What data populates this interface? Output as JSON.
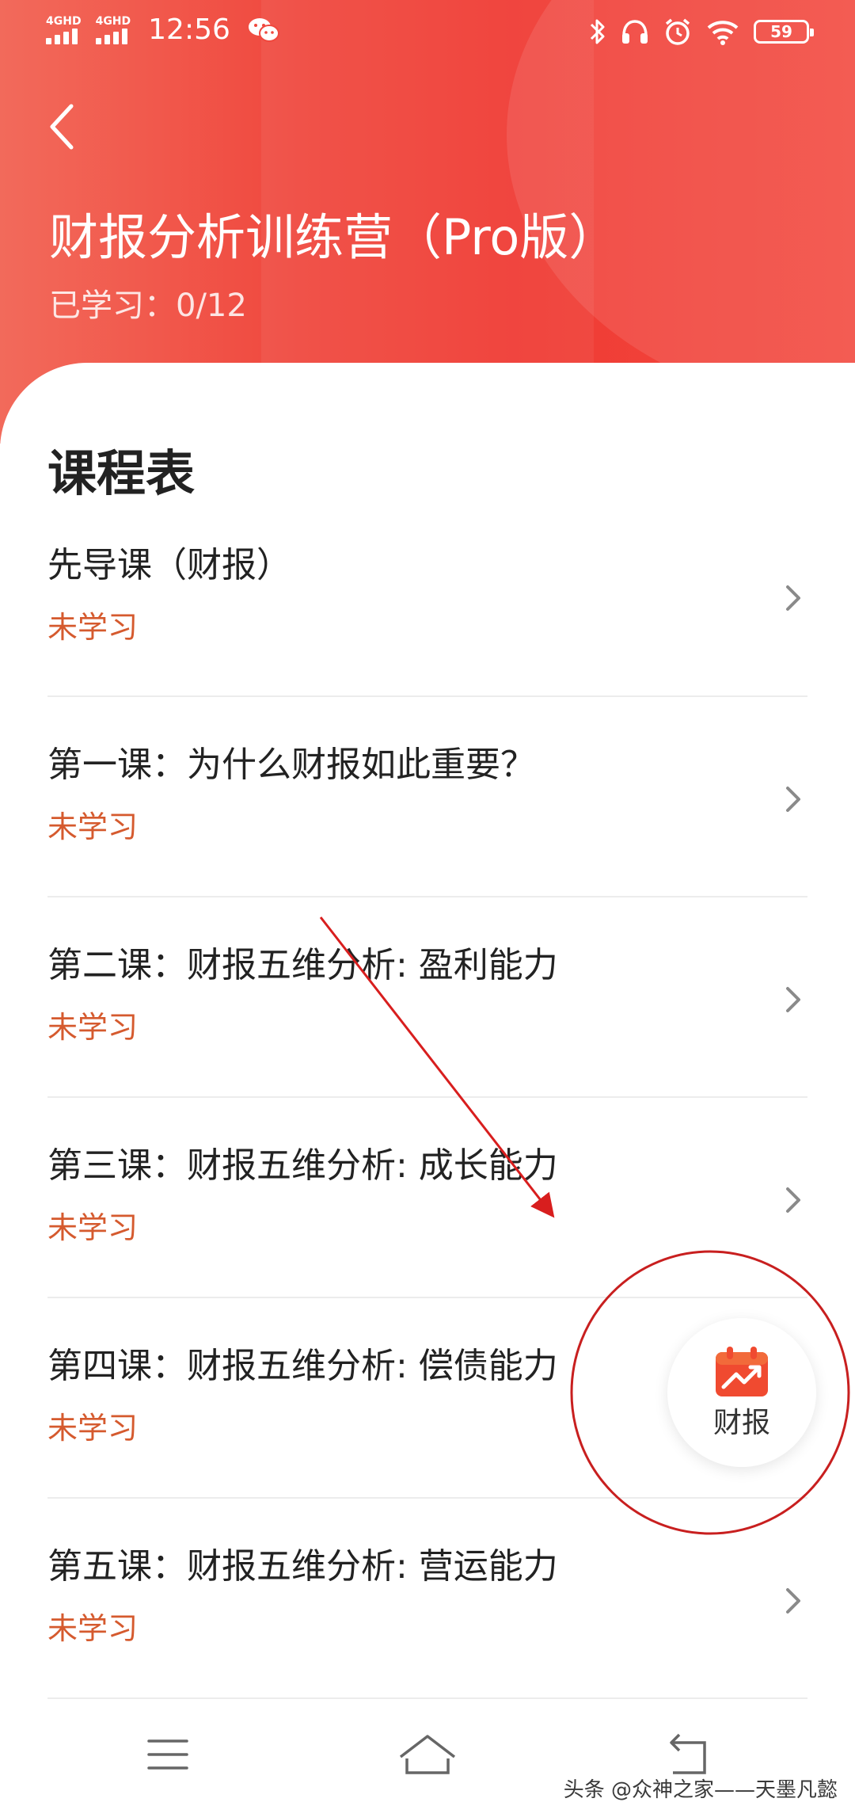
{
  "status_bar": {
    "signal_1": "4GHD",
    "signal_2": "4GHD",
    "time": "12:56",
    "battery": "59",
    "icons": [
      "wechat-icon",
      "bluetooth-icon",
      "headphones-icon",
      "alarm-icon",
      "wifi-icon",
      "battery-icon"
    ]
  },
  "header": {
    "title": "财报分析训练营（Pro版）",
    "progress": "已学习：0/12",
    "back_icon": "back-arrow-icon"
  },
  "schedule": {
    "title": "课程表",
    "lessons": [
      {
        "title": "先导课（财报）",
        "status": "未学习"
      },
      {
        "title": "第一课：为什么财报如此重要？",
        "status": "未学习"
      },
      {
        "title": "第二课：财报五维分析: 盈利能力",
        "status": "未学习"
      },
      {
        "title": "第三课：财报五维分析: 成长能力",
        "status": "未学习"
      },
      {
        "title": "第四课：财报五维分析: 偿债能力",
        "status": "未学习"
      },
      {
        "title": "第五课：财报五维分析: 营运能力",
        "status": "未学习"
      }
    ]
  },
  "float_button": {
    "label": "财报",
    "icon": "finance-report-icon"
  },
  "nav_bar": {
    "icons": [
      "menu-icon",
      "home-icon",
      "back-nav-icon"
    ]
  },
  "watermark": "头条 @众神之家——天墨凡懿",
  "colors": {
    "header_red": "#f03a33",
    "status_orange": "#d55a2e",
    "annotation_red": "#d81e1e"
  }
}
